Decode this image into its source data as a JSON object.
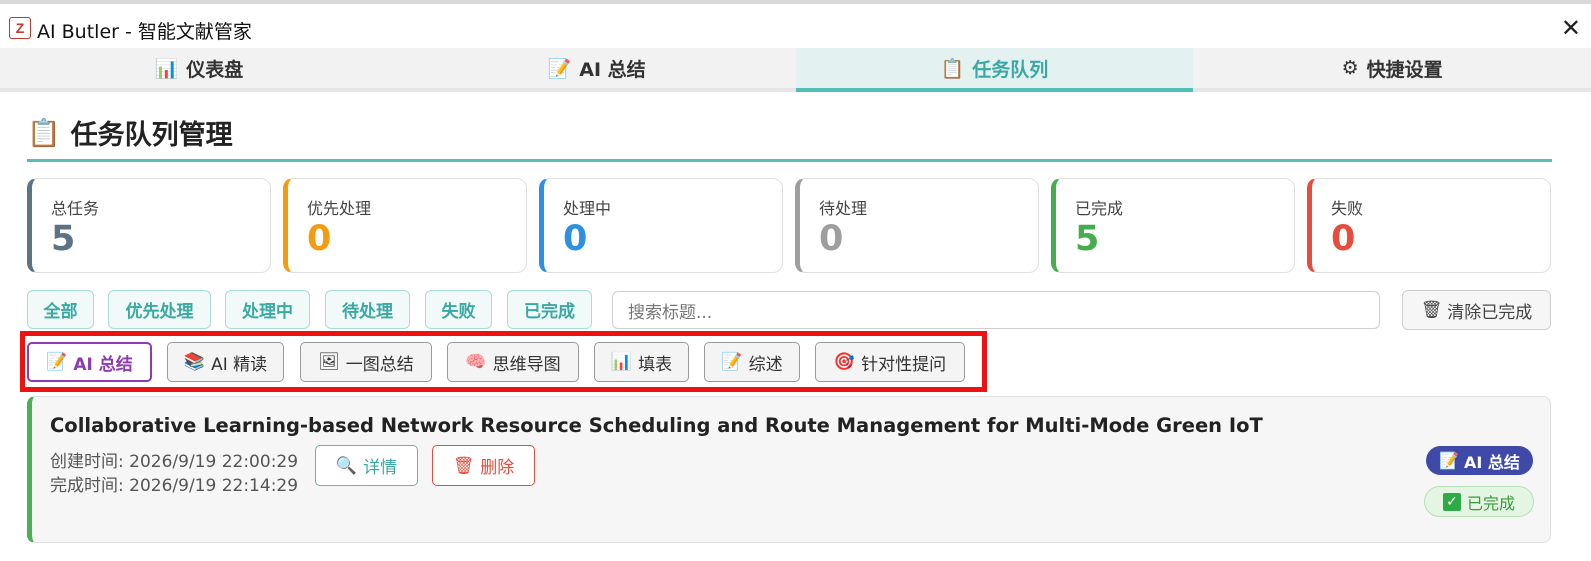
{
  "window": {
    "app_icon": "Z",
    "title": "AI Butler - 智能文献管家",
    "close": "✕"
  },
  "tabs": [
    {
      "icon": "📊",
      "label": "仪表盘"
    },
    {
      "icon": "📝",
      "label": "AI 总结"
    },
    {
      "icon": "📋",
      "label": "任务队列",
      "active": true
    },
    {
      "icon": "⚙",
      "label": "快捷设置"
    }
  ],
  "page": {
    "icon": "📋",
    "title": "任务队列管理"
  },
  "stats": [
    {
      "label": "总任务",
      "value": "5",
      "color": "#5b7382"
    },
    {
      "label": "优先处理",
      "value": "0",
      "color": "#f39c12"
    },
    {
      "label": "处理中",
      "value": "0",
      "color": "#2f8fe0"
    },
    {
      "label": "待处理",
      "value": "0",
      "color": "#9e9e9e"
    },
    {
      "label": "已完成",
      "value": "5",
      "color": "#45ad4b"
    },
    {
      "label": "失败",
      "value": "0",
      "color": "#e74c3c"
    }
  ],
  "filters": [
    "全部",
    "优先处理",
    "处理中",
    "待处理",
    "失败",
    "已完成"
  ],
  "search": {
    "placeholder": "搜索标题..."
  },
  "clear_button": {
    "icon": "🗑",
    "label": "清除已完成"
  },
  "type_filters": [
    {
      "icon": "📝",
      "label": "AI 总结",
      "active": true
    },
    {
      "icon": "📚",
      "label": "AI 精读"
    },
    {
      "icon": "🖼",
      "label": "一图总结"
    },
    {
      "icon": "🧠",
      "label": "思维导图"
    },
    {
      "icon": "📊",
      "label": "填表"
    },
    {
      "icon": "📝",
      "label": "综述"
    },
    {
      "icon": "🎯",
      "label": "针对性提问"
    }
  ],
  "task": {
    "title": "Collaborative Learning-based Network Resource Scheduling and Route Management for Multi-Mode Green IoT",
    "created": "创建时间: 2026/9/19 22:00:29",
    "completed": "完成时间: 2026/9/19 22:14:29",
    "detail": {
      "icon": "🔍",
      "label": "详情"
    },
    "delete": {
      "icon": "🗑",
      "label": "删除"
    },
    "type_badge": {
      "icon": "📝",
      "label": "AI 总结"
    },
    "status_badge": {
      "icon": "✓",
      "label": "已完成"
    }
  }
}
